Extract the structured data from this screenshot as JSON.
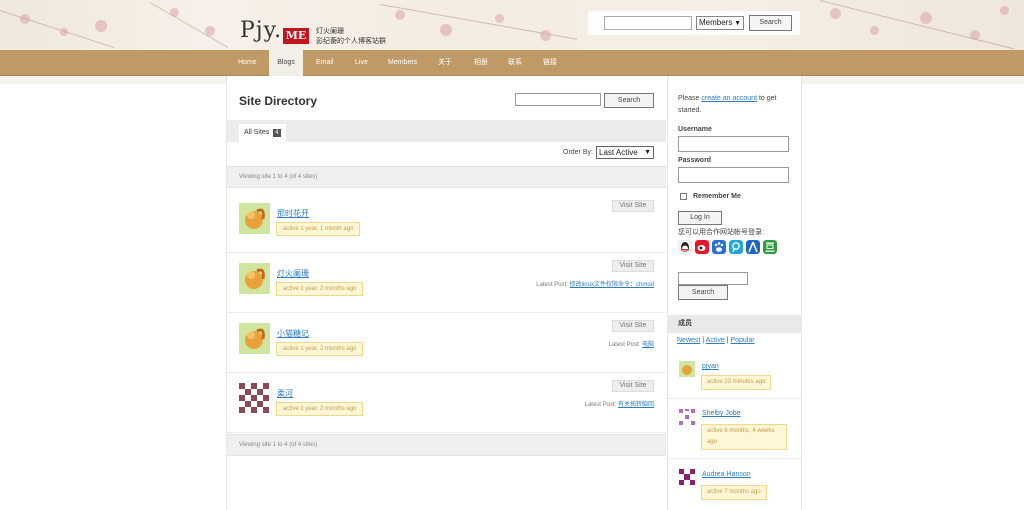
{
  "header": {
    "logo_text": "Pjy.",
    "logo_badge": "ME",
    "tagline_line1": "灯火阑珊",
    "tagline_line2": "彭纪蘅的个人博客站群",
    "search_placeholder": "",
    "search_scope": "Members",
    "search_button": "Search"
  },
  "nav": {
    "items": [
      "Home",
      "Blogs",
      "Email",
      "Live",
      "Members",
      "关于",
      "相册",
      "联系",
      "链接"
    ],
    "active": "Blogs"
  },
  "directory": {
    "title": "Site Directory",
    "search_button": "Search",
    "tab_label": "All Sites",
    "tab_count": "4",
    "order_label": "Order By:",
    "order_value": "Last Active",
    "viewing_top": "Viewing site 1 to 4 (of 4 sites)",
    "viewing_bottom": "Viewing site 1 to 4 (of 4 sites)",
    "visit_label": "Visit Site",
    "latest_label": "Latest Post:",
    "sites": [
      {
        "name": "那时花开",
        "active": "active 1 year, 1 month ago",
        "latest_post": ""
      },
      {
        "name": "灯火阑珊",
        "active": "active 1 year, 2 months ago",
        "latest_post": "修改linux文件权限命令：chmod"
      },
      {
        "name": "小猫糖记",
        "active": "active 1 year, 2 months ago",
        "latest_post": "电脑"
      },
      {
        "name": "柔河",
        "active": "active 1 year, 2 months ago",
        "latest_post": "有关拓转脑回"
      }
    ]
  },
  "sidebar": {
    "intro_before": "Please ",
    "intro_link": "create an account",
    "intro_after": " to get started.",
    "username_label": "Username",
    "password_label": "Password",
    "remember_label": "Remember Me",
    "login_button": "Log In",
    "social_text": "您可以用合作网站帐号登录:",
    "social_icons": [
      "qq-icon",
      "weibo-icon",
      "baidu-icon",
      "tencent-weibo-icon",
      "renren-icon",
      "douban-icon"
    ],
    "search_button": "Search",
    "members_title": "成员",
    "member_tabs": [
      "Newest",
      "Active",
      "Popular"
    ],
    "members": [
      {
        "name": "pjyan",
        "active": "active 23 minutes ago"
      },
      {
        "name": "Shelby Jobe",
        "active": "active 6 months, 4 weeks ago"
      },
      {
        "name": "Audrea Hanson",
        "active": "active 7 months ago"
      }
    ]
  },
  "colors": {
    "nav_bar": "#bf9a66",
    "link": "#2e7dc0",
    "logo_badge": "#c0161d",
    "active_badge_bg": "#fff6d6"
  }
}
